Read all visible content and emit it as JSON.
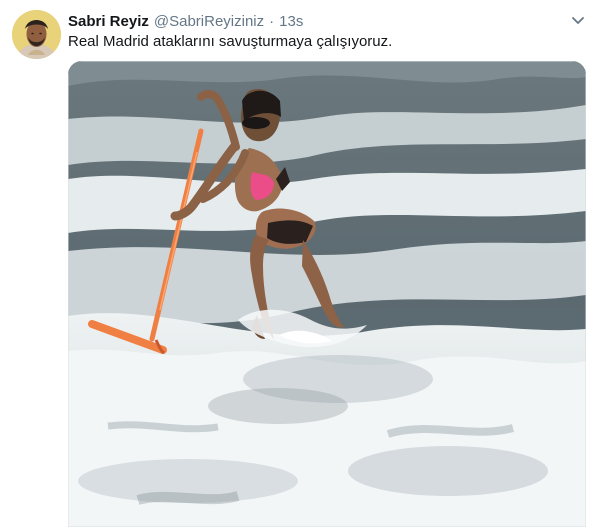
{
  "tweet": {
    "display_name": "Sabri Reyiz",
    "handle": "@SabriReyiziniz",
    "separator": "·",
    "timestamp": "13s",
    "text": "Real Madrid ataklarını savuşturmaya çalışıyoruz."
  },
  "icons": {
    "avatar": "profile-avatar",
    "menu": "chevron-down-icon"
  },
  "colors": {
    "name": "#14171a",
    "secondary": "#657786",
    "squeegee": "#f07f43",
    "sea": "#5f6d74",
    "foam": "#f2f4f5"
  }
}
